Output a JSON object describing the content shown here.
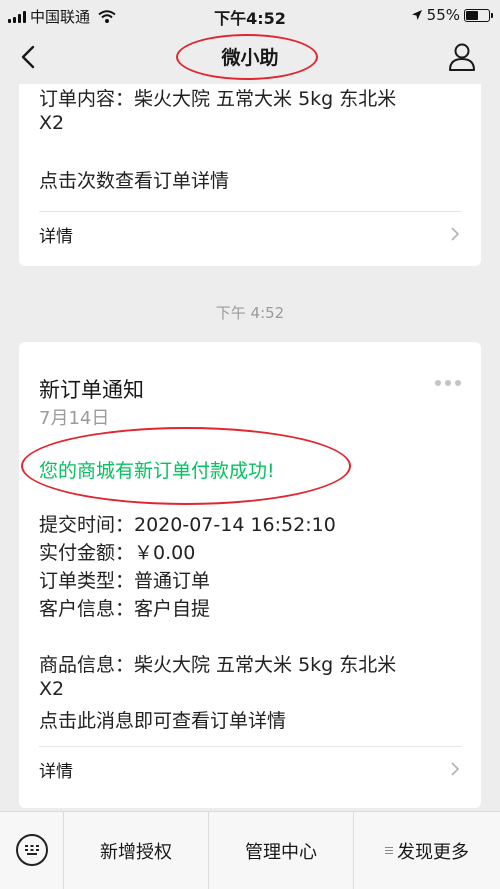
{
  "status_bar": {
    "carrier": "中国联通",
    "time": "下午4:52",
    "battery": "55%",
    "battery_level": 0.55
  },
  "nav": {
    "title": "微小助"
  },
  "card1": {
    "order_content": "订单内容：柴火大院 五常大米 5kg 东北米",
    "order_content_cont": "X2",
    "hint": "点击次数查看订单详情",
    "detail_label": "详情"
  },
  "timestamp": "下午 4:52",
  "card2": {
    "title": "新订单通知",
    "date": "7月14日",
    "success": "您的商城有新订单付款成功!",
    "submit_time": "提交时间：2020-07-14 16:52:10",
    "paid_amount": "实付金额：￥0.00",
    "order_type": "订单类型：普通订单",
    "customer": "客户信息：客户自提",
    "goods": "商品信息：柴火大院 五常大米 5kg 东北米",
    "goods_cont": "X2",
    "hint": "点击此消息即可查看订单详情",
    "detail_label": "详情"
  },
  "bottom_menu": {
    "item1": "新增授权",
    "item2": "管理中心",
    "item3": "发现更多"
  }
}
